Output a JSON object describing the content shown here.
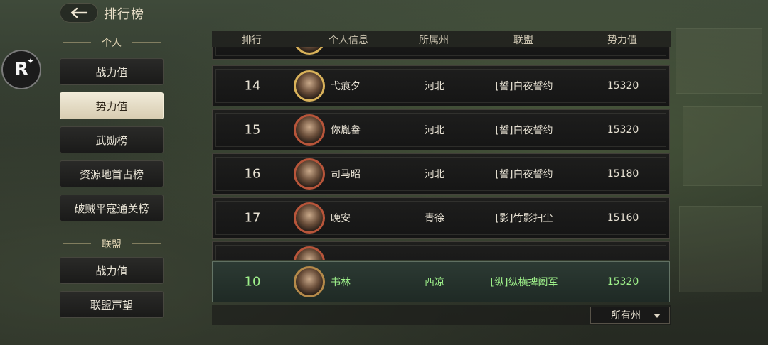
{
  "header": {
    "title": "排行榜"
  },
  "floating_button": {
    "label": "R",
    "spark": "✦"
  },
  "sidebar": {
    "personal_label": "个人",
    "personal_items": [
      {
        "label": "战力值",
        "active": false
      },
      {
        "label": "势力值",
        "active": true
      },
      {
        "label": "武勋榜",
        "active": false
      },
      {
        "label": "资源地首占榜",
        "active": false
      },
      {
        "label": "破贼平寇通关榜",
        "active": false
      }
    ],
    "alliance_label": "联盟",
    "alliance_items": [
      {
        "label": "战力值"
      },
      {
        "label": "联盟声望"
      }
    ]
  },
  "table": {
    "columns": [
      "排行",
      "个人信息",
      "所属州",
      "联盟",
      "势力值"
    ],
    "rows": [
      {
        "rank": "14",
        "name": "弋痕夕",
        "region": "河北",
        "alliance": "[誓]白夜誓约",
        "power": "15320"
      },
      {
        "rank": "15",
        "name": "你胤畚",
        "region": "河北",
        "alliance": "[誓]白夜誓约",
        "power": "15320"
      },
      {
        "rank": "16",
        "name": "司马昭",
        "region": "河北",
        "alliance": "[誓]白夜誓约",
        "power": "15180"
      },
      {
        "rank": "17",
        "name": "晚安",
        "region": "青徐",
        "alliance": "[影]竹影扫尘",
        "power": "15160"
      }
    ],
    "self": {
      "rank": "10",
      "name": "书林",
      "region": "西凉",
      "alliance": "[纵]纵横捭阖军",
      "power": "15320"
    }
  },
  "filter": {
    "selected": "所有州"
  },
  "colors": {
    "self_text": "#9ef08a",
    "active_tab": "#ece5d1"
  }
}
